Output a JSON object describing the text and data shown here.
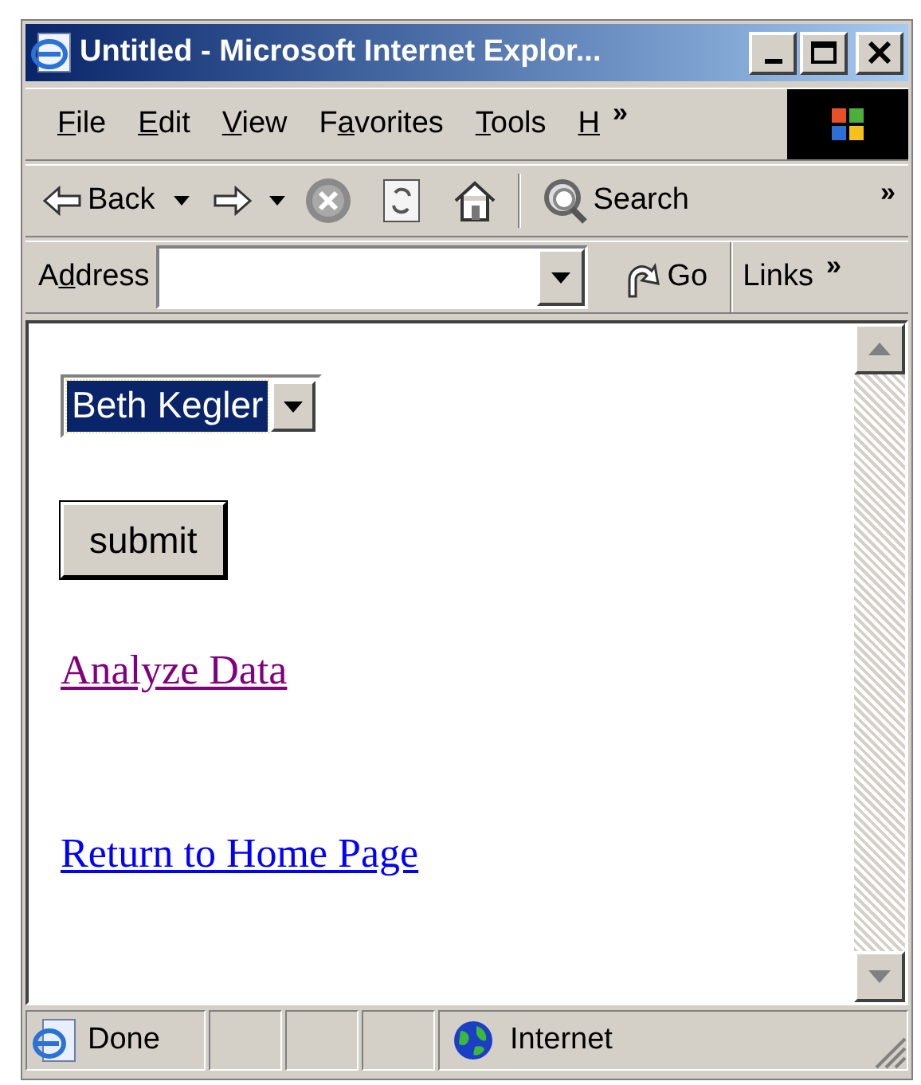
{
  "window": {
    "title": "Untitled - Microsoft Internet Explor..."
  },
  "menu": [
    {
      "parts": [
        {
          "text": "F",
          "underlined": true
        },
        {
          "text": "ile",
          "underlined": false
        }
      ]
    },
    {
      "parts": [
        {
          "text": "E",
          "underlined": true
        },
        {
          "text": "dit",
          "underlined": false
        }
      ]
    },
    {
      "parts": [
        {
          "text": "V",
          "underlined": true
        },
        {
          "text": "iew",
          "underlined": false
        }
      ]
    },
    {
      "parts": [
        {
          "text": "F",
          "underlined": false
        },
        {
          "text": "a",
          "underlined": true
        },
        {
          "text": "vorites",
          "underlined": false
        }
      ]
    },
    {
      "parts": [
        {
          "text": "T",
          "underlined": true
        },
        {
          "text": "ools",
          "underlined": false
        }
      ]
    },
    {
      "parts": [
        {
          "text": "H",
          "underlined": true
        }
      ]
    }
  ],
  "menu_overflow": "»",
  "toolbar": {
    "back": "Back",
    "search": "Search",
    "overflow": "»"
  },
  "address_bar": {
    "label_parts": [
      {
        "text": "A",
        "underlined": false
      },
      {
        "text": "d",
        "underlined": true
      },
      {
        "text": "dress",
        "underlined": false
      }
    ],
    "go": "Go",
    "links": "Links",
    "links_overflow": "»"
  },
  "content": {
    "select": {
      "value": "Beth Kegler",
      "focused": true
    },
    "submit": "submit",
    "links": [
      {
        "text": "Analyze Data",
        "visited": true
      },
      {
        "text": "Return to Home Page",
        "visited": false
      }
    ]
  },
  "status_bar": {
    "text": "Done",
    "zone": "Internet"
  }
}
